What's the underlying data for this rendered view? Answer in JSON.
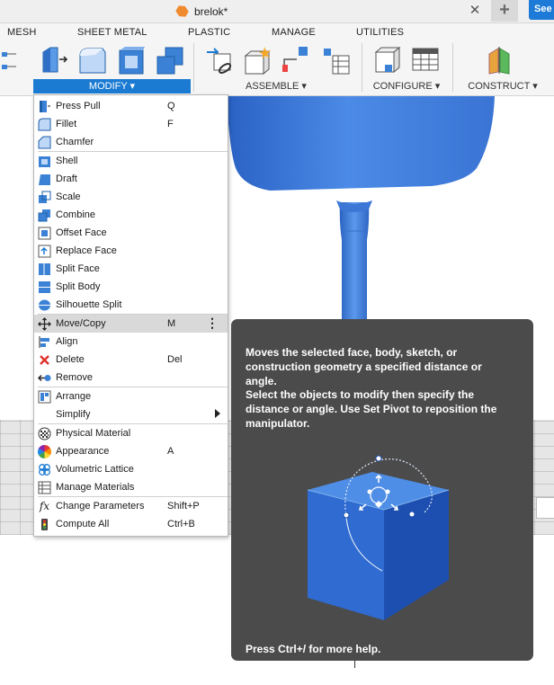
{
  "title_bar": {
    "document_title": "brelok*",
    "close_icon": "close-icon",
    "new_tab_icon": "plus-icon",
    "see_button": "See"
  },
  "ribbon": {
    "tabs": [
      "MESH",
      "SHEET METAL",
      "PLASTIC",
      "MANAGE",
      "UTILITIES"
    ],
    "groups": {
      "modify": "MODIFY ▾",
      "assemble": "ASSEMBLE ▾",
      "configure": "CONFIGURE ▾",
      "construct": "CONSTRUCT ▾"
    }
  },
  "modify_menu": {
    "items": [
      {
        "label": "Press Pull",
        "shortcut": "Q",
        "icon": "press-pull-icon"
      },
      {
        "label": "Fillet",
        "shortcut": "F",
        "icon": "fillet-icon"
      },
      {
        "label": "Chamfer",
        "shortcut": "",
        "icon": "chamfer-icon"
      },
      {
        "label": "Shell",
        "shortcut": "",
        "icon": "shell-icon"
      },
      {
        "label": "Draft",
        "shortcut": "",
        "icon": "draft-icon"
      },
      {
        "label": "Scale",
        "shortcut": "",
        "icon": "scale-icon"
      },
      {
        "label": "Combine",
        "shortcut": "",
        "icon": "combine-icon"
      },
      {
        "label": "Offset Face",
        "shortcut": "",
        "icon": "offset-face-icon"
      },
      {
        "label": "Replace Face",
        "shortcut": "",
        "icon": "replace-face-icon"
      },
      {
        "label": "Split Face",
        "shortcut": "",
        "icon": "split-face-icon"
      },
      {
        "label": "Split Body",
        "shortcut": "",
        "icon": "split-body-icon"
      },
      {
        "label": "Silhouette Split",
        "shortcut": "",
        "icon": "silhouette-split-icon"
      },
      {
        "label": "Move/Copy",
        "shortcut": "M",
        "icon": "move-copy-icon"
      },
      {
        "label": "Align",
        "shortcut": "",
        "icon": "align-icon"
      },
      {
        "label": "Delete",
        "shortcut": "Del",
        "icon": "delete-icon"
      },
      {
        "label": "Remove",
        "shortcut": "",
        "icon": "remove-icon"
      },
      {
        "label": "Arrange",
        "shortcut": "",
        "icon": "arrange-icon"
      },
      {
        "label": "Simplify",
        "shortcut": "",
        "icon": "simplify-icon"
      },
      {
        "label": "Physical Material",
        "shortcut": "",
        "icon": "physical-material-icon"
      },
      {
        "label": "Appearance",
        "shortcut": "A",
        "icon": "appearance-icon"
      },
      {
        "label": "Volumetric Lattice",
        "shortcut": "",
        "icon": "volumetric-lattice-icon"
      },
      {
        "label": "Manage Materials",
        "shortcut": "",
        "icon": "manage-materials-icon"
      },
      {
        "label": "Change Parameters",
        "shortcut": "Shift+P",
        "icon": "change-parameters-icon"
      },
      {
        "label": "Compute All",
        "shortcut": "Ctrl+B",
        "icon": "compute-all-icon"
      }
    ],
    "highlighted_item": "Move/Copy"
  },
  "tooltip": {
    "description": "Moves the selected face, body, sketch, or construction geometry a specified distance or angle.",
    "instructions": "Select the objects to modify then specify the distance or angle. Use Set Pivot to reposition the manipulator.",
    "help_hint": "Press Ctrl+/ for more help."
  },
  "colors": {
    "accent": "#1b7bd2",
    "model_blue": "#3b78d8",
    "tooltip_bg": "#4b4b4b"
  }
}
